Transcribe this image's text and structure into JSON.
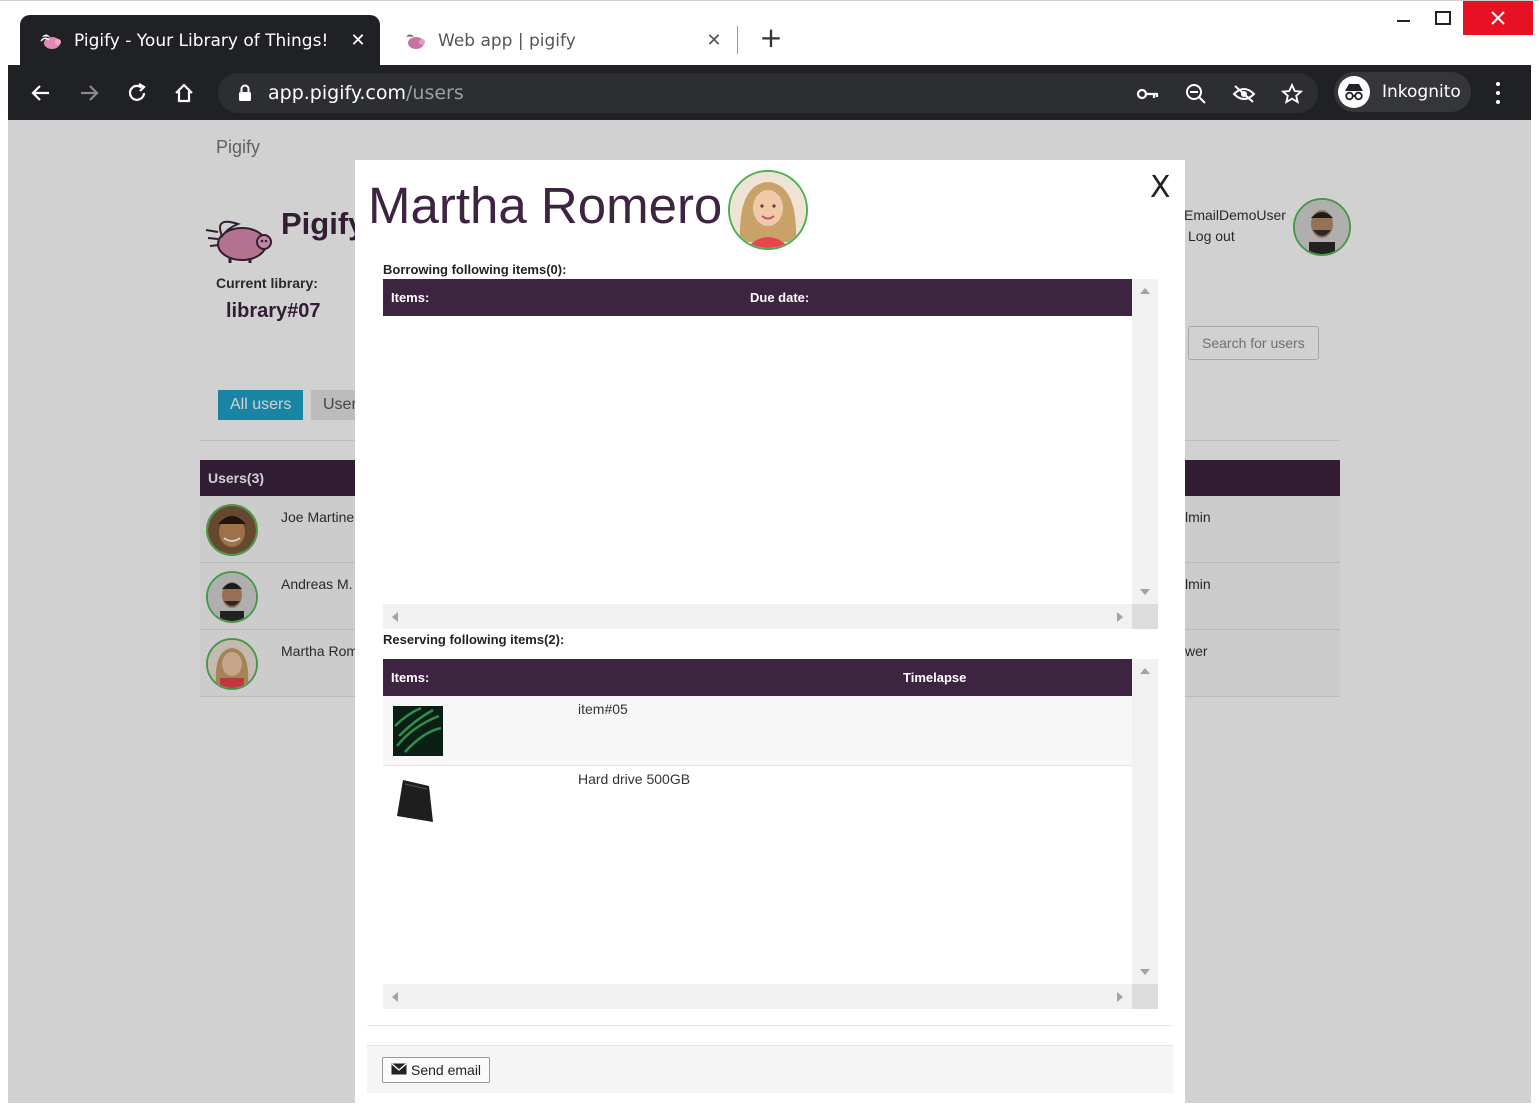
{
  "browser": {
    "tabs": [
      {
        "title": "Pigify - Your Library of Things!",
        "active": true
      },
      {
        "title": "Web app | pigify",
        "active": false
      }
    ],
    "url_host": "app.pigify.com",
    "url_path": "/users",
    "incognito_label": "Inkognito"
  },
  "page": {
    "brand_link": "Pigify",
    "app_name": "Pigify",
    "current_library_label": "Current library:",
    "current_library": "library#07",
    "tabs": [
      "All users",
      "User"
    ],
    "account_name": "EmailDemoUser",
    "logout": "Log out",
    "search_placeholder": "Search for users",
    "users_header": "Users(3)",
    "users": [
      {
        "name": "Joe Martine",
        "role": "lmin"
      },
      {
        "name": "Andreas M.",
        "role": "lmin"
      },
      {
        "name": "Martha Rom",
        "role": "wer"
      }
    ]
  },
  "modal": {
    "title": "Martha Romero",
    "close": "X",
    "borrowing": {
      "label": "Borrowing following items(0):",
      "col_items": "Items:",
      "col_due": "Due date:"
    },
    "reserving": {
      "label": "Reserving following items(2):",
      "col_items": "Items:",
      "col_timelapse": "Timelapse",
      "rows": [
        {
          "name": "item#05"
        },
        {
          "name": "Hard drive 500GB"
        }
      ]
    },
    "send_email": "Send email"
  },
  "colors": {
    "brand_purple": "#3d2440",
    "primary_tab": "#1fa3c9",
    "avatar_ring": "#4caf50",
    "close_red": "#e81123"
  }
}
